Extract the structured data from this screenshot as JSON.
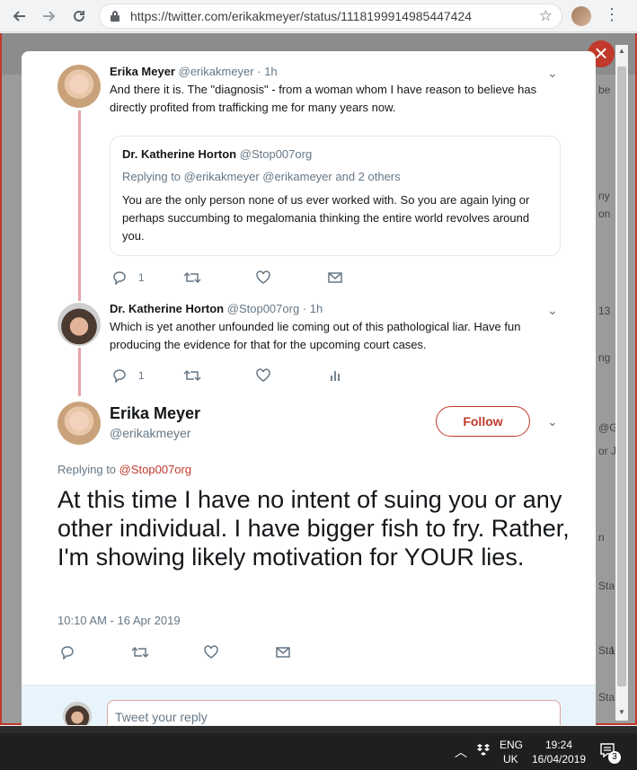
{
  "browser": {
    "url": "https://twitter.com/erikakmeyer/status/1118199914985447424",
    "back_icon": "arrow-left-icon",
    "forward_icon": "arrow-right-icon",
    "reload_icon": "reload-icon"
  },
  "tweets": [
    {
      "name": "Erika Meyer",
      "handle": "@erikakmeyer",
      "time": "· 1h",
      "text": "And there it is. The \"diagnosis\" - from a woman whom I have reason to believe has directly profited from trafficking me for many years now.",
      "quote": {
        "name": "Dr. Katherine Horton",
        "handle": "@Stop007org",
        "replying": "Replying to @erikakmeyer @erikameyer and 2 others",
        "text": "You are the only person none of us ever worked with. So you are again lying or perhaps succumbing to megalomania thinking the entire world revolves around you."
      },
      "reply_count": "1"
    },
    {
      "name": "Dr. Katherine Horton",
      "handle": "@Stop007org",
      "time": "· 1h",
      "text": "Which is yet another unfounded lie coming out of this pathological liar. Have fun producing the evidence for that for the upcoming court cases.",
      "reply_count": "1"
    }
  ],
  "main_tweet": {
    "name": "Erika Meyer",
    "handle": "@erikakmeyer",
    "follow_label": "Follow",
    "replying_prefix": "Replying to",
    "replying_handle": "@Stop007org",
    "text": "At this time I have no intent of suing you or any other individual. I have bigger fish to fry. Rather, I'm showing likely motivation for YOUR lies.",
    "timestamp": "10:10 AM - 16 Apr 2019"
  },
  "reply_box": {
    "placeholder": "Tweet your reply"
  },
  "background_snippets": [
    "be",
    "ny",
    "on",
    "13",
    "ng",
    "@G",
    "or J",
    "n",
    "Sta",
    "Sta",
    "1",
    "Sta"
  ],
  "taskbar": {
    "lang_top": "ENG",
    "lang_bottom": "UK",
    "time": "19:24",
    "date": "16/04/2019",
    "notifications": "3"
  },
  "colors": {
    "accent": "#c0392b",
    "thread_line": "#e6a4a7",
    "text_secondary": "#657786"
  }
}
